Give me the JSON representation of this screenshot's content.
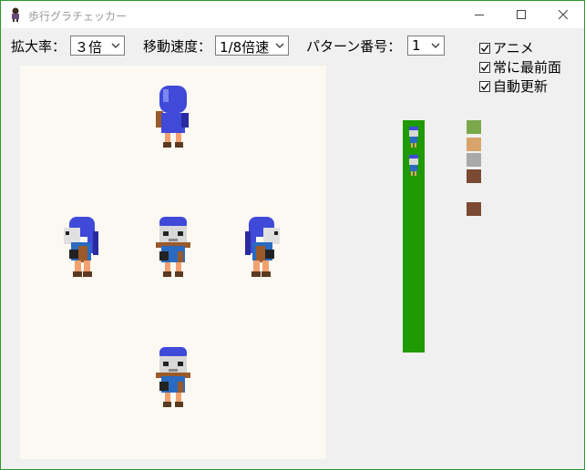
{
  "window": {
    "title": "歩行グラチェッカー"
  },
  "controls": {
    "zoom_label": "拡大率：",
    "zoom_value": "３倍",
    "speed_label": "移動速度：",
    "speed_value": "1/8倍速",
    "pattern_label": "パターン番号：",
    "pattern_value": "1"
  },
  "options": [
    {
      "label": "アニメ",
      "checked": true
    },
    {
      "label": "常に最前面",
      "checked": true
    },
    {
      "label": "自動更新",
      "checked": true
    }
  ],
  "sprites": [
    {
      "direction": "up"
    },
    {
      "direction": "left"
    },
    {
      "direction": "down"
    },
    {
      "direction": "right"
    },
    {
      "direction": "down"
    }
  ],
  "strip": {
    "color": "#1f9a00"
  },
  "tiles": [
    {
      "color": "#7aa84a"
    },
    {
      "color": "#d9a46c"
    },
    {
      "color": "#a9a9a9"
    },
    {
      "color": "#7a4a32"
    },
    {
      "color": "#7a4a32"
    }
  ]
}
